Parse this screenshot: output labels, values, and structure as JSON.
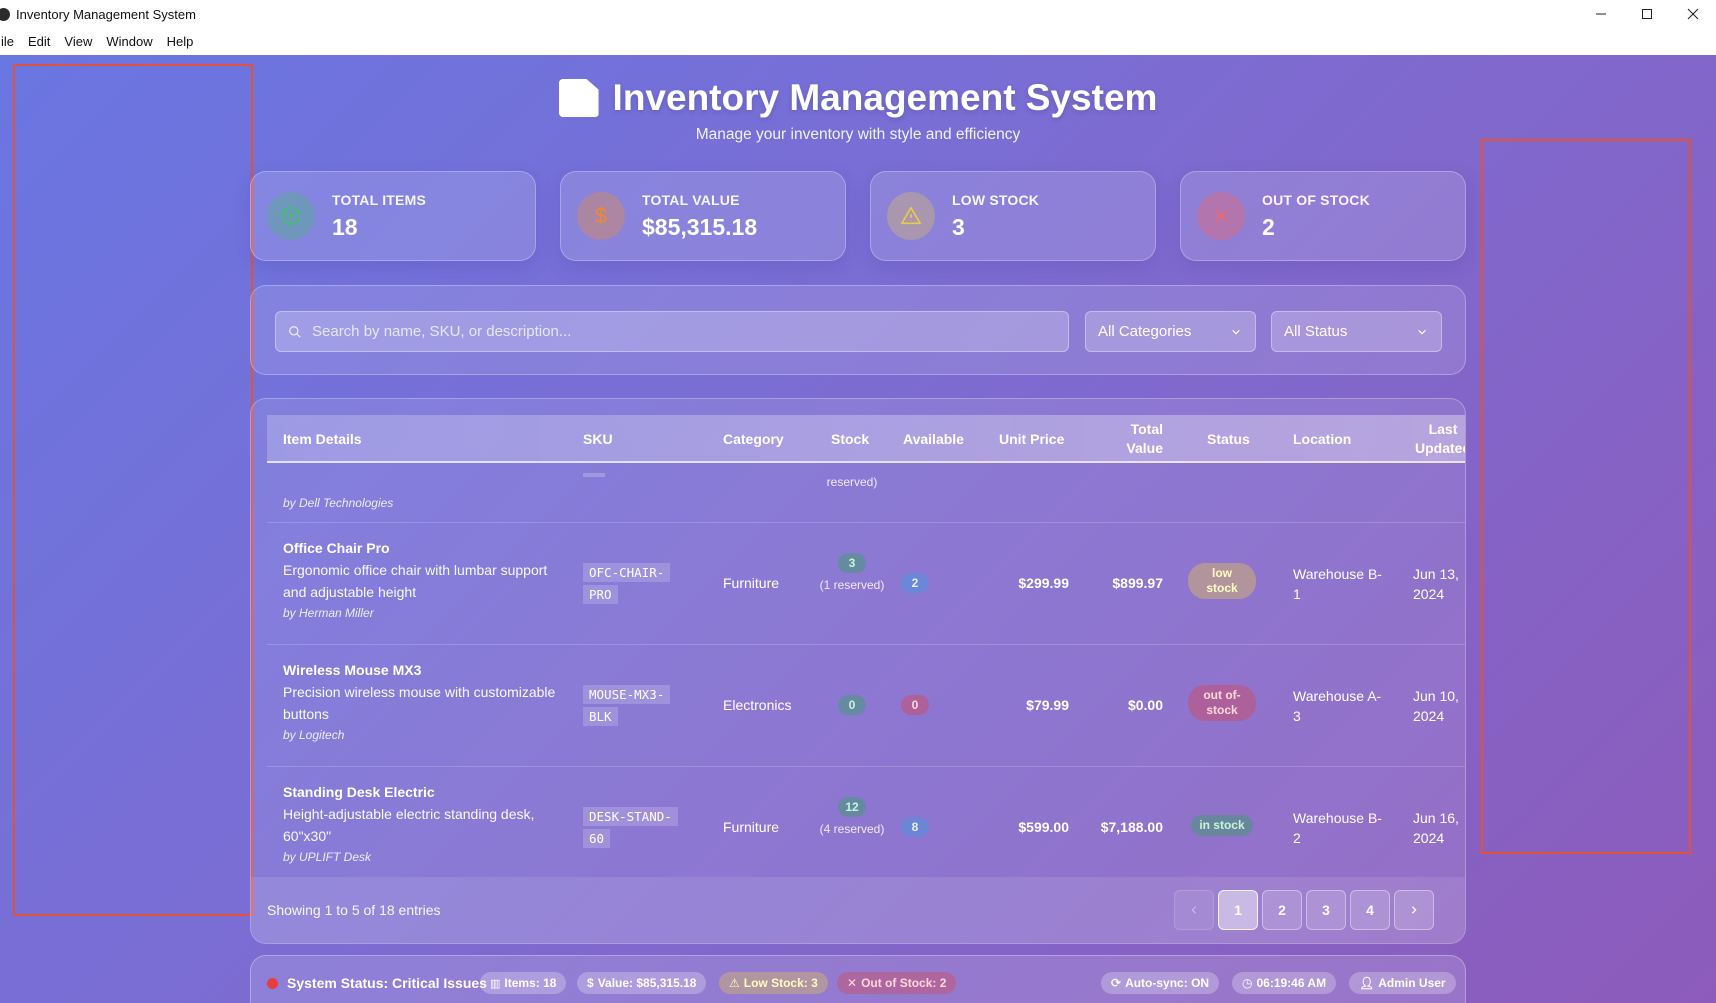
{
  "window": {
    "title": "Inventory Management System"
  },
  "menu": [
    "ile",
    "Edit",
    "View",
    "Window",
    "Help"
  ],
  "header": {
    "title": "Inventory Management System",
    "subtitle": "Manage your inventory with style and efficiency"
  },
  "stats": [
    {
      "label": "TOTAL ITEMS",
      "value": "18",
      "icon": "box-icon",
      "color": "#38a169"
    },
    {
      "label": "TOTAL VALUE",
      "value": "$85,315.18",
      "icon": "dollar-icon",
      "color": "#dd6b20"
    },
    {
      "label": "LOW STOCK",
      "value": "3",
      "icon": "warning-icon",
      "color": "#d69e2e"
    },
    {
      "label": "OUT OF STOCK",
      "value": "2",
      "icon": "x-icon",
      "color": "#e53e3e"
    }
  ],
  "filters": {
    "search_placeholder": "Search by name, SKU, or description...",
    "category": "All Categories",
    "status": "All Status"
  },
  "table": {
    "headers": [
      "Item Details",
      "SKU",
      "Category",
      "Stock",
      "Available",
      "Unit Price",
      "Total Value",
      "Status",
      "Location",
      "Last Updated"
    ],
    "partial_row": {
      "brand": "by Dell Technologies",
      "reserved": "reserved)"
    },
    "rows": [
      {
        "name": "Office Chair Pro",
        "desc": "Ergonomic office chair with lumbar support and adjustable height",
        "brand": "by Herman Miller",
        "sku": "OFC-CHAIR-PRO",
        "category": "Furniture",
        "stock": "3",
        "reserved": "(1 reserved)",
        "available": "2",
        "unit_price": "$299.99",
        "total": "$899.97",
        "status": "low stock",
        "location": "Warehouse B-1",
        "updated": "Jun 13, 2024"
      },
      {
        "name": "Wireless Mouse MX3",
        "desc": "Precision wireless mouse with customizable buttons",
        "brand": "by Logitech",
        "sku": "MOUSE-MX3-BLK",
        "category": "Electronics",
        "stock": "0",
        "reserved": "",
        "available": "0",
        "unit_price": "$79.99",
        "total": "$0.00",
        "status": "out of-stock",
        "location": "Warehouse A-3",
        "updated": "Jun 10, 2024"
      },
      {
        "name": "Standing Desk Electric",
        "desc": "Height-adjustable electric standing desk, 60\"x30\"",
        "brand": "by UPLIFT Desk",
        "sku": "DESK-STAND-60",
        "category": "Furniture",
        "stock": "12",
        "reserved": "(4 reserved)",
        "available": "8",
        "unit_price": "$599.00",
        "total": "$7,188.00",
        "status": "in stock",
        "location": "Warehouse B-2",
        "updated": "Jun 16, 2024"
      }
    ]
  },
  "pagination": {
    "showing": "Showing 1 to 5 of 18 entries",
    "pages": [
      "1",
      "2",
      "3",
      "4"
    ],
    "active": "1"
  },
  "statusbar": {
    "system": "System Status: Critical Issues",
    "items": "Items: 18",
    "value": "Value: $85,315.18",
    "low": "Low Stock: 3",
    "out": "Out of Stock: 2",
    "sync": "Auto-sync: ON",
    "time": "06:19:46 AM",
    "user": "Admin User"
  }
}
